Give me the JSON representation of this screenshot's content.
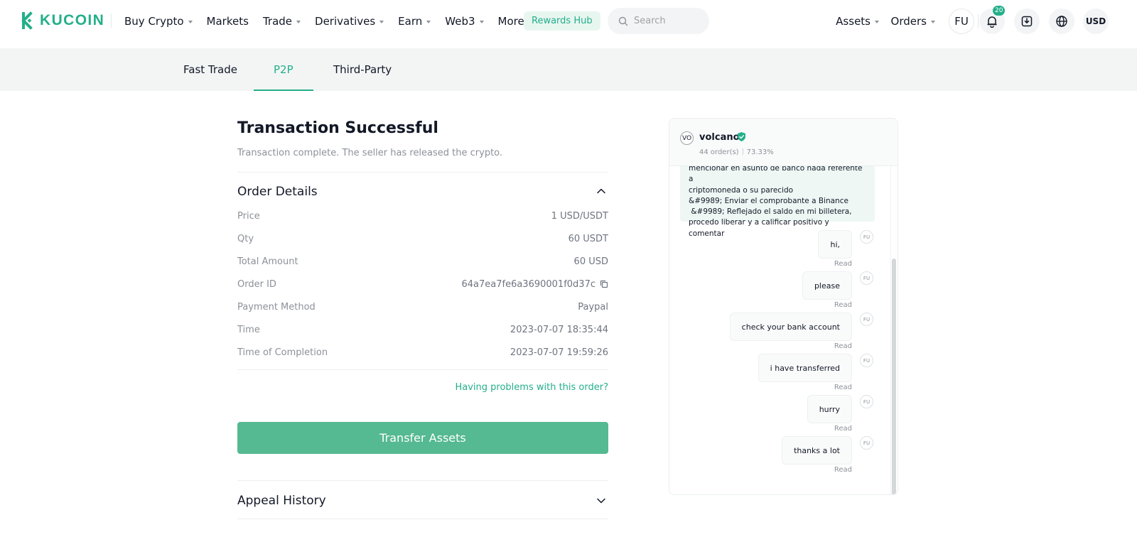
{
  "header": {
    "logo_text": "KUCOIN",
    "nav": [
      {
        "label": "Buy Crypto",
        "caret": true
      },
      {
        "label": "Markets",
        "caret": false
      },
      {
        "label": "Trade",
        "caret": true
      },
      {
        "label": "Derivatives",
        "caret": true
      },
      {
        "label": "Earn",
        "caret": true
      },
      {
        "label": "Web3",
        "caret": true
      },
      {
        "label": "More",
        "caret": true
      }
    ],
    "rewards_label": "Rewards Hub",
    "search_placeholder": "Search",
    "assets_label": "Assets",
    "orders_label": "Orders",
    "user_initials": "FU",
    "notification_count": "20",
    "currency": "USD",
    "brand_color": "#23af8a"
  },
  "subnav": {
    "tabs": [
      {
        "label": "Fast Trade",
        "active": false
      },
      {
        "label": "P2P",
        "active": true
      },
      {
        "label": "Third-Party",
        "active": false
      }
    ]
  },
  "order": {
    "title": "Transaction Successful",
    "subtitle": "Transaction complete. The seller has released the crypto.",
    "details_title": "Order Details",
    "rows": [
      {
        "label": "Price",
        "value": "1 USD/USDT"
      },
      {
        "label": "Qty",
        "value": "60 USDT"
      },
      {
        "label": "Total Amount",
        "value": "60 USD"
      },
      {
        "label": "Order ID",
        "value": "64a7ea7fe6a3690001f0d37c"
      },
      {
        "label": "Payment Method",
        "value": "Paypal"
      },
      {
        "label": "Time",
        "value": "2023-07-07 18:35:44"
      },
      {
        "label": "Time of Completion",
        "value": "2023-07-07 19:59:26"
      }
    ],
    "problems_link": "Having problems with this order?",
    "transfer_button": "Transfer Assets",
    "appeal_title": "Appeal History"
  },
  "chat": {
    "seller_avatar": "VO",
    "seller_name": "volcano",
    "seller_orders": "44 order(s)",
    "seller_rate": "73.33%",
    "system_lines": [
      "mencionar en asunto de banco nada referente a",
      "criptomoneda o su parecido",
      "&#9989; Enviar el comprobante a Binance",
      " &#9989; Reflejado el saldo en mi billetera,",
      "procedo liberar y a calificar positivo y comentar"
    ],
    "messages": [
      {
        "text": "hi,",
        "status": "Read",
        "avatar": "FU"
      },
      {
        "text": "please",
        "status": "Read",
        "avatar": "FU"
      },
      {
        "text": "check your bank account",
        "status": "Read",
        "avatar": "FU"
      },
      {
        "text": "i have transferred",
        "status": "Read",
        "avatar": "FU"
      },
      {
        "text": "hurry",
        "status": "Read",
        "avatar": "FU"
      },
      {
        "text": "thanks a lot",
        "status": "Read",
        "avatar": "FU"
      }
    ]
  }
}
